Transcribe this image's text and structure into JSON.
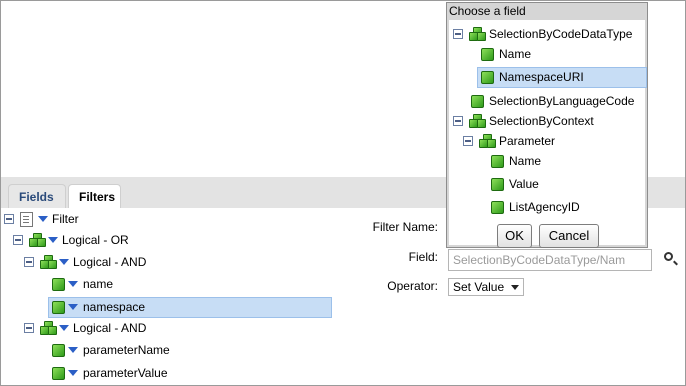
{
  "tabs": [
    {
      "label": "Fields"
    },
    {
      "label": "Filters"
    }
  ],
  "tree": {
    "root": "Filter",
    "or": "Logical - OR",
    "and1": "Logical - AND",
    "name": "name",
    "namespace": "namespace",
    "and2": "Logical - AND",
    "parameterName": "parameterName",
    "parameterValue": "parameterValue"
  },
  "form": {
    "filter_name_label": "Filter Name:",
    "field_label": "Field:",
    "field_value": "SelectionByCodeDataType/Nam",
    "operator_label": "Operator:",
    "operator_value": "Set Value"
  },
  "popup": {
    "title": "Choose a field",
    "items": {
      "codeDataType": "SelectionByCodeDataType",
      "name": "Name",
      "namespaceURI": "NamespaceURI",
      "languageCode": "SelectionByLanguageCode",
      "context": "SelectionByContext",
      "parameter": "Parameter",
      "pname": "Name",
      "pvalue": "Value",
      "listAgencyID": "ListAgencyID"
    },
    "ok_label": "OK",
    "cancel_label": "Cancel"
  }
}
